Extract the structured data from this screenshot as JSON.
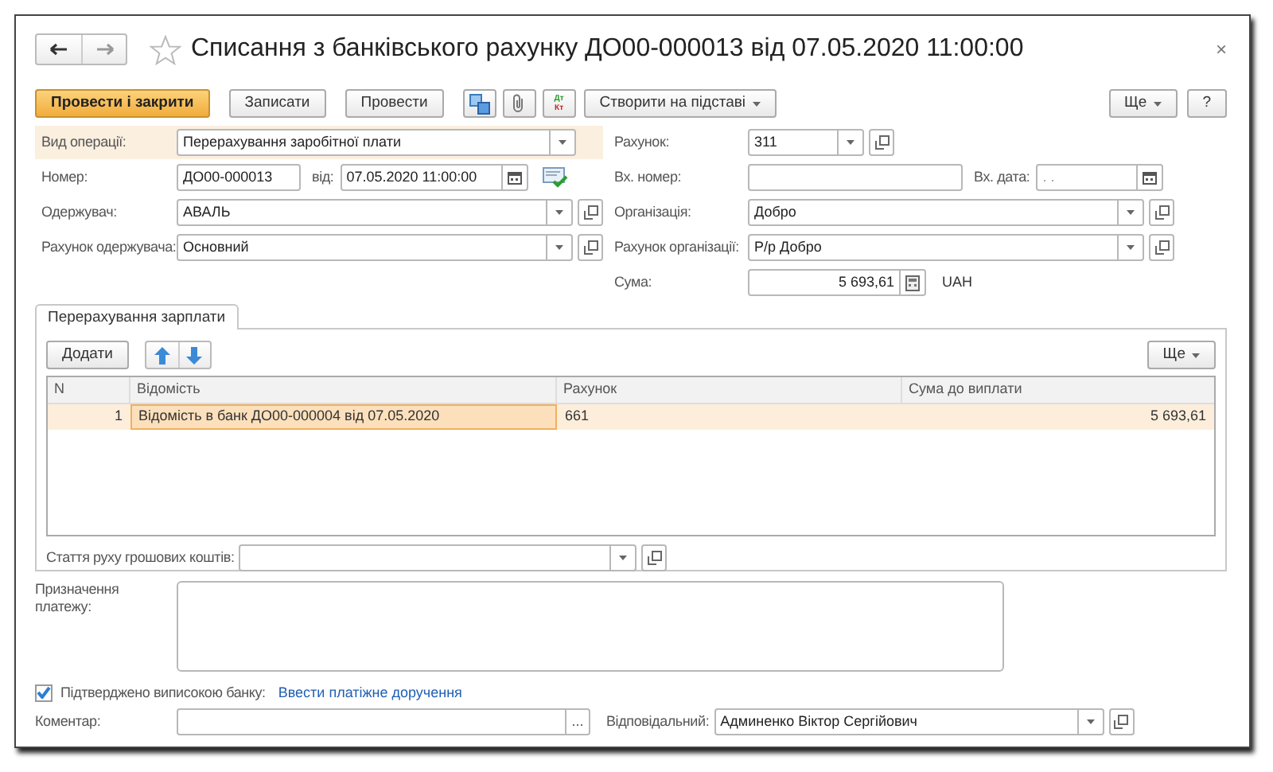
{
  "window": {
    "title": "Списання з банківського рахунку ДО00-000013 від 07.05.2020 11:00:00",
    "close": "×"
  },
  "toolbar": {
    "left": [
      {
        "kind": "primary",
        "label": "Провести і закрити"
      },
      {
        "kind": "plain",
        "label": "Записати"
      },
      {
        "kind": "plain",
        "label": "Провести"
      },
      {
        "kind": "structure"
      },
      {
        "kind": "clip"
      },
      {
        "kind": "dtkt",
        "top": "Дт",
        "bottom": "Кт"
      },
      {
        "kind": "menu",
        "label": "Створити на підставі"
      }
    ],
    "right": [
      {
        "kind": "menu",
        "label": "Ще"
      },
      {
        "kind": "plain",
        "label": "?"
      }
    ]
  },
  "form": {
    "rows": [
      {
        "left": [
          {
            "label": "Вид операції:",
            "kind": "select_noopen",
            "value": "Перерахування заробітної плати",
            "focused": true
          }
        ],
        "right": [
          {
            "label": "Рахунок:",
            "kind": "select_short",
            "value": "311",
            "focused": false
          }
        ]
      },
      {
        "left": [
          {
            "label": "Номер:",
            "kind": "text",
            "value": "ДО00-000013",
            "focused": false
          },
          {
            "label": "від:",
            "kind": "datetime",
            "value": "07.05.2020 11:00:00",
            "focused": false
          }
        ],
        "right": [
          {
            "label": "Вх. номер:",
            "kind": "text",
            "focused": false
          },
          {
            "label": "Вх. дата:",
            "kind": "date",
            "placeholder": " .  .",
            "focused": false
          }
        ]
      },
      {
        "left": [
          {
            "label": "Одержувач:",
            "kind": "select",
            "value": "АВАЛЬ",
            "focused": false
          }
        ],
        "right": [
          {
            "label": "Організація:",
            "kind": "select",
            "value": "Добро",
            "focused": false
          }
        ]
      },
      {
        "left": [
          {
            "label": "Рахунок одержувача:",
            "kind": "select",
            "value": "Основний",
            "focused": false
          }
        ],
        "right": [
          {
            "label": "Рахунок організації:",
            "kind": "select",
            "value": "Р/р Добро",
            "focused": false
          }
        ]
      },
      {
        "right": [
          {
            "label": "Сума:",
            "kind": "amount",
            "value": "5 693,61",
            "unit": "UAH",
            "focused": false
          }
        ]
      }
    ]
  },
  "tabs": [
    {
      "label": "Перерахування зарплати",
      "selected": true
    }
  ],
  "tab_panel": {
    "add": "Додати",
    "more": "Ще",
    "table": {
      "columns": [
        "N",
        "Відомість",
        "Рахунок",
        "Сума до виплати"
      ],
      "rows": [
        {
          "selected": true,
          "cells": [
            {
              "text": "1",
              "focused": false
            },
            {
              "text": "Відомість в банк ДО00-000004 від 07.05.2020",
              "focused": true
            },
            {
              "text": "661",
              "focused": false
            },
            {
              "text": "5 693,61",
              "focused": false
            }
          ]
        }
      ]
    },
    "cash_flow": {
      "label": "Стаття руху грошових коштів:",
      "kind": "select",
      "focused": false
    }
  },
  "purpose": {
    "label": "Призначення платежу:"
  },
  "bank_confirmed": {
    "label": "Підтверджено виписокою банку:",
    "checked": true
  },
  "link": "Ввести платіжне доручення",
  "bottom": [
    {
      "label": "Коментар:",
      "kind": "comment",
      "button": "...",
      "focused": false
    },
    {
      "label": "Відповідальний:",
      "kind": "select",
      "value": "Админенко Віктор Сергійович",
      "focused": false
    }
  ]
}
